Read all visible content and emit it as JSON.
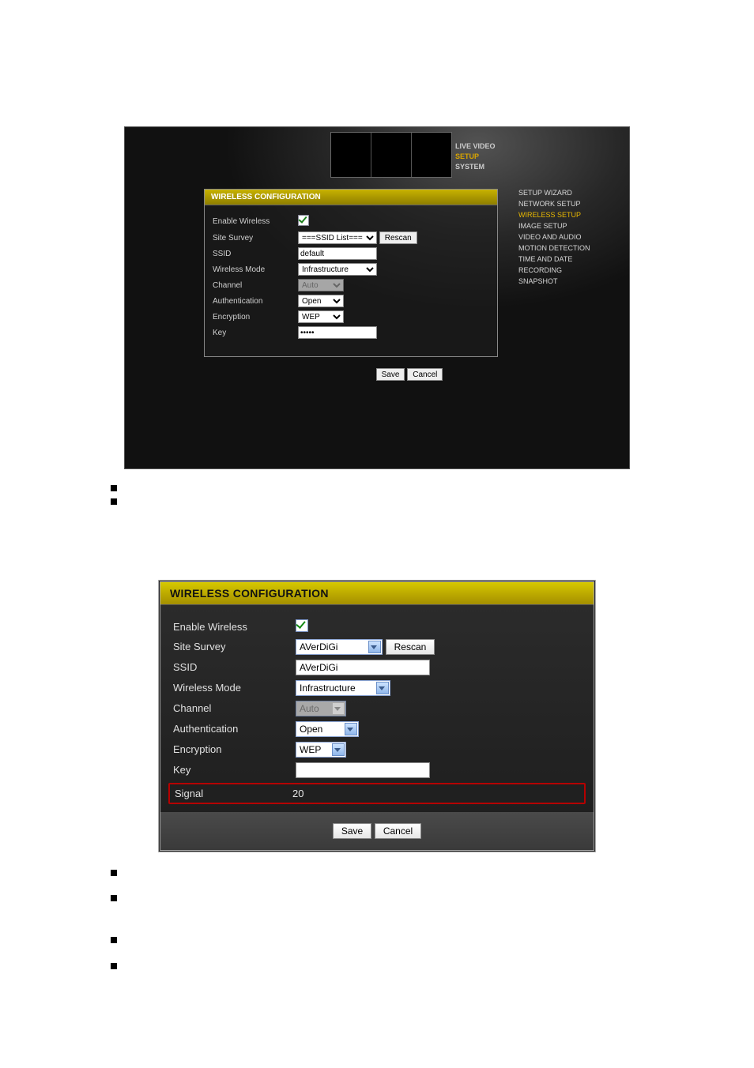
{
  "navTabs": {
    "live": "LIVE VIDEO",
    "setup": "SETUP",
    "system": "SYSTEM"
  },
  "sidebar": {
    "items": [
      "SETUP WIZARD",
      "NETWORK SETUP",
      "WIRELESS SETUP",
      "IMAGE SETUP",
      "VIDEO AND AUDIO",
      "MOTION DETECTION",
      "TIME AND DATE",
      "RECORDING",
      "SNAPSHOT"
    ],
    "activeIndex": 2
  },
  "panelTitle": "WIRELESS CONFIGURATION",
  "labels": {
    "enableWireless": "Enable Wireless",
    "siteSurvey": "Site Survey",
    "ssid": "SSID",
    "wirelessMode": "Wireless Mode",
    "channel": "Channel",
    "authentication": "Authentication",
    "encryption": "Encryption",
    "key": "Key",
    "signal": "Signal"
  },
  "topForm": {
    "siteSurveyList": "===SSID List===",
    "rescan": "Rescan",
    "ssid": "default",
    "wirelessMode": "Infrastructure",
    "channel": "Auto",
    "authentication": "Open",
    "encryption": "WEP",
    "key": "•••••"
  },
  "bigForm": {
    "siteSurveySelected": "AVerDiGi",
    "rescan": "Rescan",
    "ssid": "AVerDiGi",
    "wirelessMode": "Infrastructure",
    "channel": "Auto",
    "authentication": "Open",
    "encryption": "WEP",
    "key": "",
    "signal": "20"
  },
  "buttons": {
    "save": "Save",
    "cancel": "Cancel"
  }
}
